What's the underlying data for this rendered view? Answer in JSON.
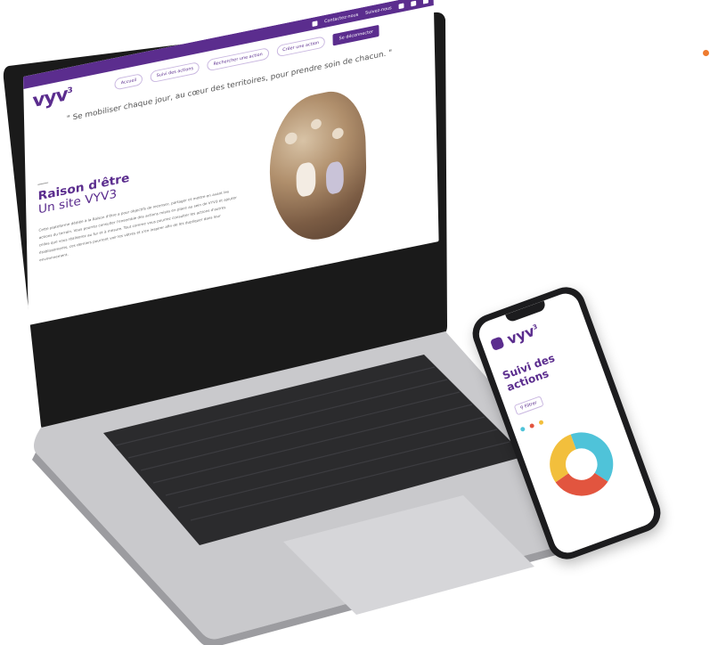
{
  "laptop": {
    "topbar": {
      "contact": "Contactez-nous",
      "follow": "Suivez-nous"
    },
    "nav": {
      "logo": "vyv",
      "logo_sup": "3",
      "items": [
        {
          "label": "Accueil"
        },
        {
          "label": "Suivi des actions"
        },
        {
          "label": "Rechercher une action"
        },
        {
          "label": "Créer une action"
        }
      ],
      "logout": "Se déconnecter"
    },
    "quote": "\" Se mobiliser chaque jour, au cœur des territoires, pour prendre soin de chacun. \"",
    "section_title": "Raison d'être",
    "section_subtitle": "Un site VYV3",
    "paragraph": "Cette plateforme dédiée à la Raison d'être a pour objectifs de recenser, partager et mettre en avant les actions du terrain. Vous pourrez consulter l'ensemble des actions mises en place au sein de VYV3 et ajouter celles que vous réaliserez au fur et à mesure. Tout comme vous pourrez consulter les actions d'autres établissements, ces derniers pourront voir les vôtres et s'en inspirer afin de les dupliquer dans leur environnement."
  },
  "phone": {
    "logo": "vyv",
    "logo_sup": "3",
    "title_line1": "Suivi des",
    "title_line2": "actions",
    "filter": "Filtrer",
    "colors": {
      "purple": "#5b2d8e",
      "cyan": "#4fc3d9",
      "red": "#e2553f",
      "yellow": "#f2bf3c",
      "accent_dot": "#ee7b2f"
    }
  }
}
